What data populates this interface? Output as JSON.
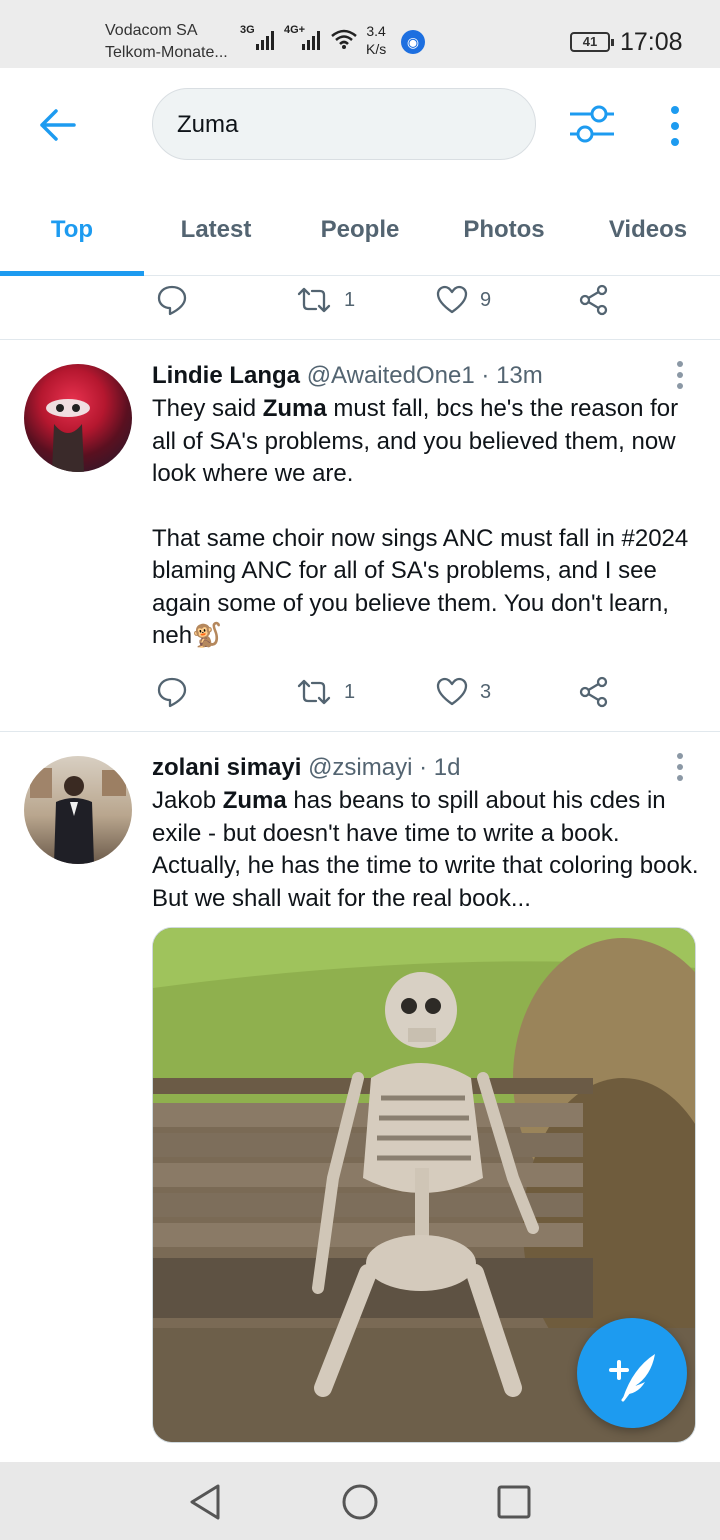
{
  "status_bar": {
    "carrier_1": "Vodacom SA",
    "carrier_2": "Telkom-Monate...",
    "net_1": "3G",
    "net_2": "4G+",
    "speed_value": "3.4",
    "speed_unit": "K/s",
    "battery": "41",
    "time": "17:08"
  },
  "header": {
    "search_query": "Zuma",
    "back_icon": "arrow-left-icon",
    "filter_icon": "sliders-icon",
    "more_icon": "more-vertical-icon"
  },
  "tabs": [
    {
      "label": "Top",
      "active": true
    },
    {
      "label": "Latest",
      "active": false
    },
    {
      "label": "People",
      "active": false
    },
    {
      "label": "Photos",
      "active": false
    },
    {
      "label": "Videos",
      "active": false
    }
  ],
  "prev_tweet_actions": {
    "retweets": "1",
    "likes": "9"
  },
  "tweets": [
    {
      "name": "Lindie Langa",
      "handle": "@AwaitedOne1",
      "sep": "·",
      "time": "13m",
      "text_p1_before": "They said ",
      "text_p1_bold": "Zuma",
      "text_p1_after": " must fall, bcs he's the reason for all of SA's problems, and you believed them, now look where we are.",
      "text_p2": "That same choir now sings ANC must fall in #2024 blaming ANC for all of SA's problems, and I see again some of you believe them. You don't learn, neh",
      "emoji": "🐒",
      "retweets": "1",
      "likes": "3"
    },
    {
      "name": "zolani simayi",
      "handle": "@zsimayi",
      "sep": "·",
      "time": "1d",
      "text_before": "Jakob ",
      "text_bold": "Zuma",
      "text_after": " has beans to spill about his cdes in exile - but doesn't have time to write a book. Actually, he has the time to write that coloring book. But we shall wait for the real book..."
    }
  ],
  "colors": {
    "accent": "#1d9bf0",
    "secondary_text": "#536471",
    "status_bg": "#ececec",
    "nav_bg": "#e8e8e8"
  }
}
